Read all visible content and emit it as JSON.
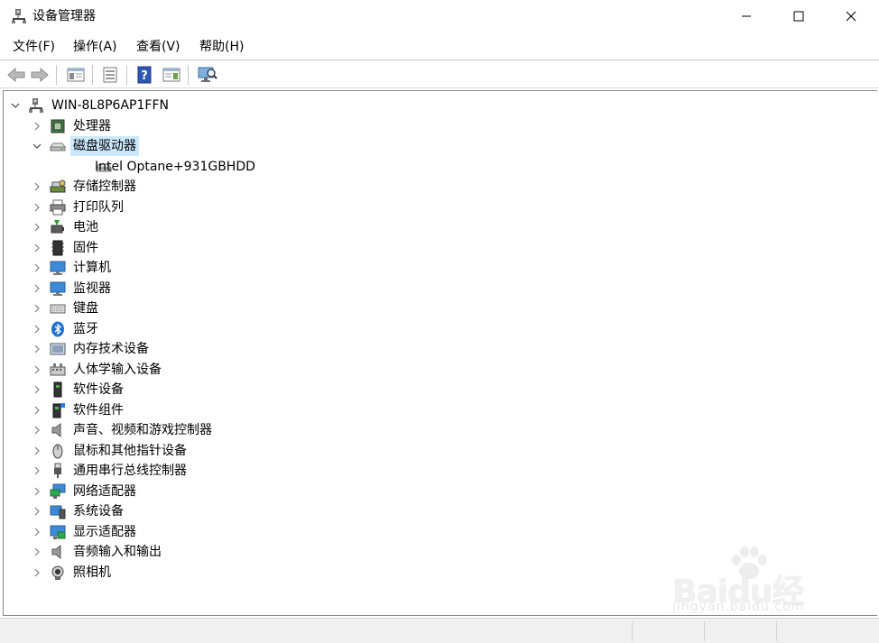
{
  "window": {
    "title": "设备管理器",
    "controls": {
      "minimize": "minimize",
      "maximize": "maximize",
      "close": "close"
    }
  },
  "menu": [
    {
      "label": "文件(F)"
    },
    {
      "label": "操作(A)"
    },
    {
      "label": "查看(V)"
    },
    {
      "label": "帮助(H)"
    }
  ],
  "toolbar": [
    {
      "icon": "back-arrow-icon",
      "enabled": false
    },
    {
      "icon": "forward-arrow-icon",
      "enabled": false
    },
    {
      "icon": "show-hide-console-tree-icon",
      "enabled": true
    },
    {
      "icon": "properties-icon",
      "enabled": true
    },
    {
      "icon": "help-icon",
      "enabled": true
    },
    {
      "icon": "action-pane-icon",
      "enabled": true
    },
    {
      "icon": "scan-hardware-changes-icon",
      "enabled": true
    }
  ],
  "tree": {
    "root": {
      "label": "WIN-8L8P6AP1FFN",
      "icon": "computer-network-icon",
      "expanded": true
    },
    "categories": [
      {
        "label": "处理器",
        "icon": "processor-icon",
        "expanded": false
      },
      {
        "label": "磁盘驱动器",
        "icon": "disk-drive-icon",
        "expanded": true,
        "selected": true,
        "children": [
          {
            "label": "Intel Optane+931GBHDD",
            "icon": "disk-drive-icon"
          }
        ]
      },
      {
        "label": "存储控制器",
        "icon": "storage-controller-icon",
        "expanded": false
      },
      {
        "label": "打印队列",
        "icon": "printer-icon",
        "expanded": false
      },
      {
        "label": "电池",
        "icon": "battery-icon",
        "expanded": false
      },
      {
        "label": "固件",
        "icon": "firmware-chip-icon",
        "expanded": false
      },
      {
        "label": "计算机",
        "icon": "computer-monitor-icon",
        "expanded": false
      },
      {
        "label": "监视器",
        "icon": "monitor-icon",
        "expanded": false
      },
      {
        "label": "键盘",
        "icon": "keyboard-icon",
        "expanded": false
      },
      {
        "label": "蓝牙",
        "icon": "bluetooth-icon",
        "expanded": false
      },
      {
        "label": "内存技术设备",
        "icon": "memory-device-icon",
        "expanded": false
      },
      {
        "label": "人体学输入设备",
        "icon": "hid-icon",
        "expanded": false
      },
      {
        "label": "软件设备",
        "icon": "software-device-icon",
        "expanded": false
      },
      {
        "label": "软件组件",
        "icon": "software-component-icon",
        "expanded": false
      },
      {
        "label": "声音、视频和游戏控制器",
        "icon": "speaker-icon",
        "expanded": false
      },
      {
        "label": "鼠标和其他指针设备",
        "icon": "mouse-icon",
        "expanded": false
      },
      {
        "label": "通用串行总线控制器",
        "icon": "usb-icon",
        "expanded": false
      },
      {
        "label": "网络适配器",
        "icon": "network-adapter-icon",
        "expanded": false
      },
      {
        "label": "系统设备",
        "icon": "system-device-icon",
        "expanded": false
      },
      {
        "label": "显示适配器",
        "icon": "display-adapter-icon",
        "expanded": false
      },
      {
        "label": "音频输入和输出",
        "icon": "audio-io-icon",
        "expanded": false
      },
      {
        "label": "照相机",
        "icon": "camera-icon",
        "expanded": false
      }
    ]
  },
  "watermark": {
    "main": "Baidu经验",
    "sub": "jingyan.baidu.com"
  },
  "colors": {
    "selection": "#cce8ff",
    "statusbar": "#f0f0f0",
    "accent": "#0078d7"
  }
}
